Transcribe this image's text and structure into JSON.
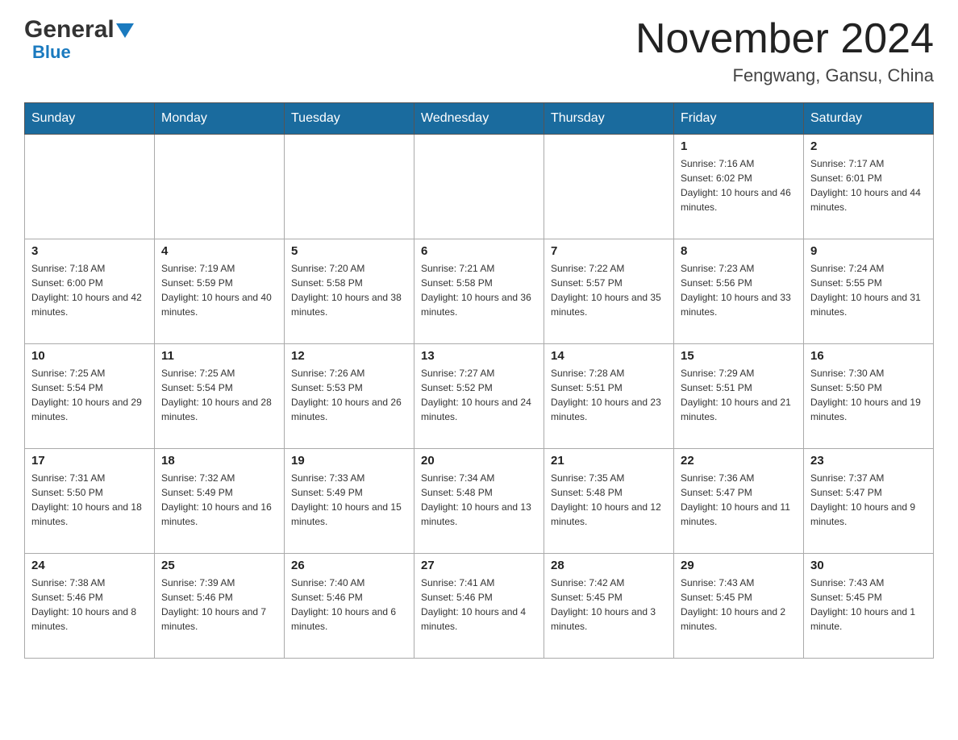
{
  "header": {
    "logo_general": "General",
    "logo_blue": "Blue",
    "month_title": "November 2024",
    "location": "Fengwang, Gansu, China"
  },
  "weekdays": [
    "Sunday",
    "Monday",
    "Tuesday",
    "Wednesday",
    "Thursday",
    "Friday",
    "Saturday"
  ],
  "weeks": [
    {
      "days": [
        {
          "number": "",
          "empty": true
        },
        {
          "number": "",
          "empty": true
        },
        {
          "number": "",
          "empty": true
        },
        {
          "number": "",
          "empty": true
        },
        {
          "number": "",
          "empty": true
        },
        {
          "number": "1",
          "sunrise": "7:16 AM",
          "sunset": "6:02 PM",
          "daylight": "10 hours and 46 minutes."
        },
        {
          "number": "2",
          "sunrise": "7:17 AM",
          "sunset": "6:01 PM",
          "daylight": "10 hours and 44 minutes."
        }
      ]
    },
    {
      "days": [
        {
          "number": "3",
          "sunrise": "7:18 AM",
          "sunset": "6:00 PM",
          "daylight": "10 hours and 42 minutes."
        },
        {
          "number": "4",
          "sunrise": "7:19 AM",
          "sunset": "5:59 PM",
          "daylight": "10 hours and 40 minutes."
        },
        {
          "number": "5",
          "sunrise": "7:20 AM",
          "sunset": "5:58 PM",
          "daylight": "10 hours and 38 minutes."
        },
        {
          "number": "6",
          "sunrise": "7:21 AM",
          "sunset": "5:58 PM",
          "daylight": "10 hours and 36 minutes."
        },
        {
          "number": "7",
          "sunrise": "7:22 AM",
          "sunset": "5:57 PM",
          "daylight": "10 hours and 35 minutes."
        },
        {
          "number": "8",
          "sunrise": "7:23 AM",
          "sunset": "5:56 PM",
          "daylight": "10 hours and 33 minutes."
        },
        {
          "number": "9",
          "sunrise": "7:24 AM",
          "sunset": "5:55 PM",
          "daylight": "10 hours and 31 minutes."
        }
      ]
    },
    {
      "days": [
        {
          "number": "10",
          "sunrise": "7:25 AM",
          "sunset": "5:54 PM",
          "daylight": "10 hours and 29 minutes."
        },
        {
          "number": "11",
          "sunrise": "7:25 AM",
          "sunset": "5:54 PM",
          "daylight": "10 hours and 28 minutes."
        },
        {
          "number": "12",
          "sunrise": "7:26 AM",
          "sunset": "5:53 PM",
          "daylight": "10 hours and 26 minutes."
        },
        {
          "number": "13",
          "sunrise": "7:27 AM",
          "sunset": "5:52 PM",
          "daylight": "10 hours and 24 minutes."
        },
        {
          "number": "14",
          "sunrise": "7:28 AM",
          "sunset": "5:51 PM",
          "daylight": "10 hours and 23 minutes."
        },
        {
          "number": "15",
          "sunrise": "7:29 AM",
          "sunset": "5:51 PM",
          "daylight": "10 hours and 21 minutes."
        },
        {
          "number": "16",
          "sunrise": "7:30 AM",
          "sunset": "5:50 PM",
          "daylight": "10 hours and 19 minutes."
        }
      ]
    },
    {
      "days": [
        {
          "number": "17",
          "sunrise": "7:31 AM",
          "sunset": "5:50 PM",
          "daylight": "10 hours and 18 minutes."
        },
        {
          "number": "18",
          "sunrise": "7:32 AM",
          "sunset": "5:49 PM",
          "daylight": "10 hours and 16 minutes."
        },
        {
          "number": "19",
          "sunrise": "7:33 AM",
          "sunset": "5:49 PM",
          "daylight": "10 hours and 15 minutes."
        },
        {
          "number": "20",
          "sunrise": "7:34 AM",
          "sunset": "5:48 PM",
          "daylight": "10 hours and 13 minutes."
        },
        {
          "number": "21",
          "sunrise": "7:35 AM",
          "sunset": "5:48 PM",
          "daylight": "10 hours and 12 minutes."
        },
        {
          "number": "22",
          "sunrise": "7:36 AM",
          "sunset": "5:47 PM",
          "daylight": "10 hours and 11 minutes."
        },
        {
          "number": "23",
          "sunrise": "7:37 AM",
          "sunset": "5:47 PM",
          "daylight": "10 hours and 9 minutes."
        }
      ]
    },
    {
      "days": [
        {
          "number": "24",
          "sunrise": "7:38 AM",
          "sunset": "5:46 PM",
          "daylight": "10 hours and 8 minutes."
        },
        {
          "number": "25",
          "sunrise": "7:39 AM",
          "sunset": "5:46 PM",
          "daylight": "10 hours and 7 minutes."
        },
        {
          "number": "26",
          "sunrise": "7:40 AM",
          "sunset": "5:46 PM",
          "daylight": "10 hours and 6 minutes."
        },
        {
          "number": "27",
          "sunrise": "7:41 AM",
          "sunset": "5:46 PM",
          "daylight": "10 hours and 4 minutes."
        },
        {
          "number": "28",
          "sunrise": "7:42 AM",
          "sunset": "5:45 PM",
          "daylight": "10 hours and 3 minutes."
        },
        {
          "number": "29",
          "sunrise": "7:43 AM",
          "sunset": "5:45 PM",
          "daylight": "10 hours and 2 minutes."
        },
        {
          "number": "30",
          "sunrise": "7:43 AM",
          "sunset": "5:45 PM",
          "daylight": "10 hours and 1 minute."
        }
      ]
    }
  ],
  "labels": {
    "sunrise_prefix": "Sunrise: ",
    "sunset_prefix": "Sunset: ",
    "daylight_prefix": "Daylight: "
  }
}
